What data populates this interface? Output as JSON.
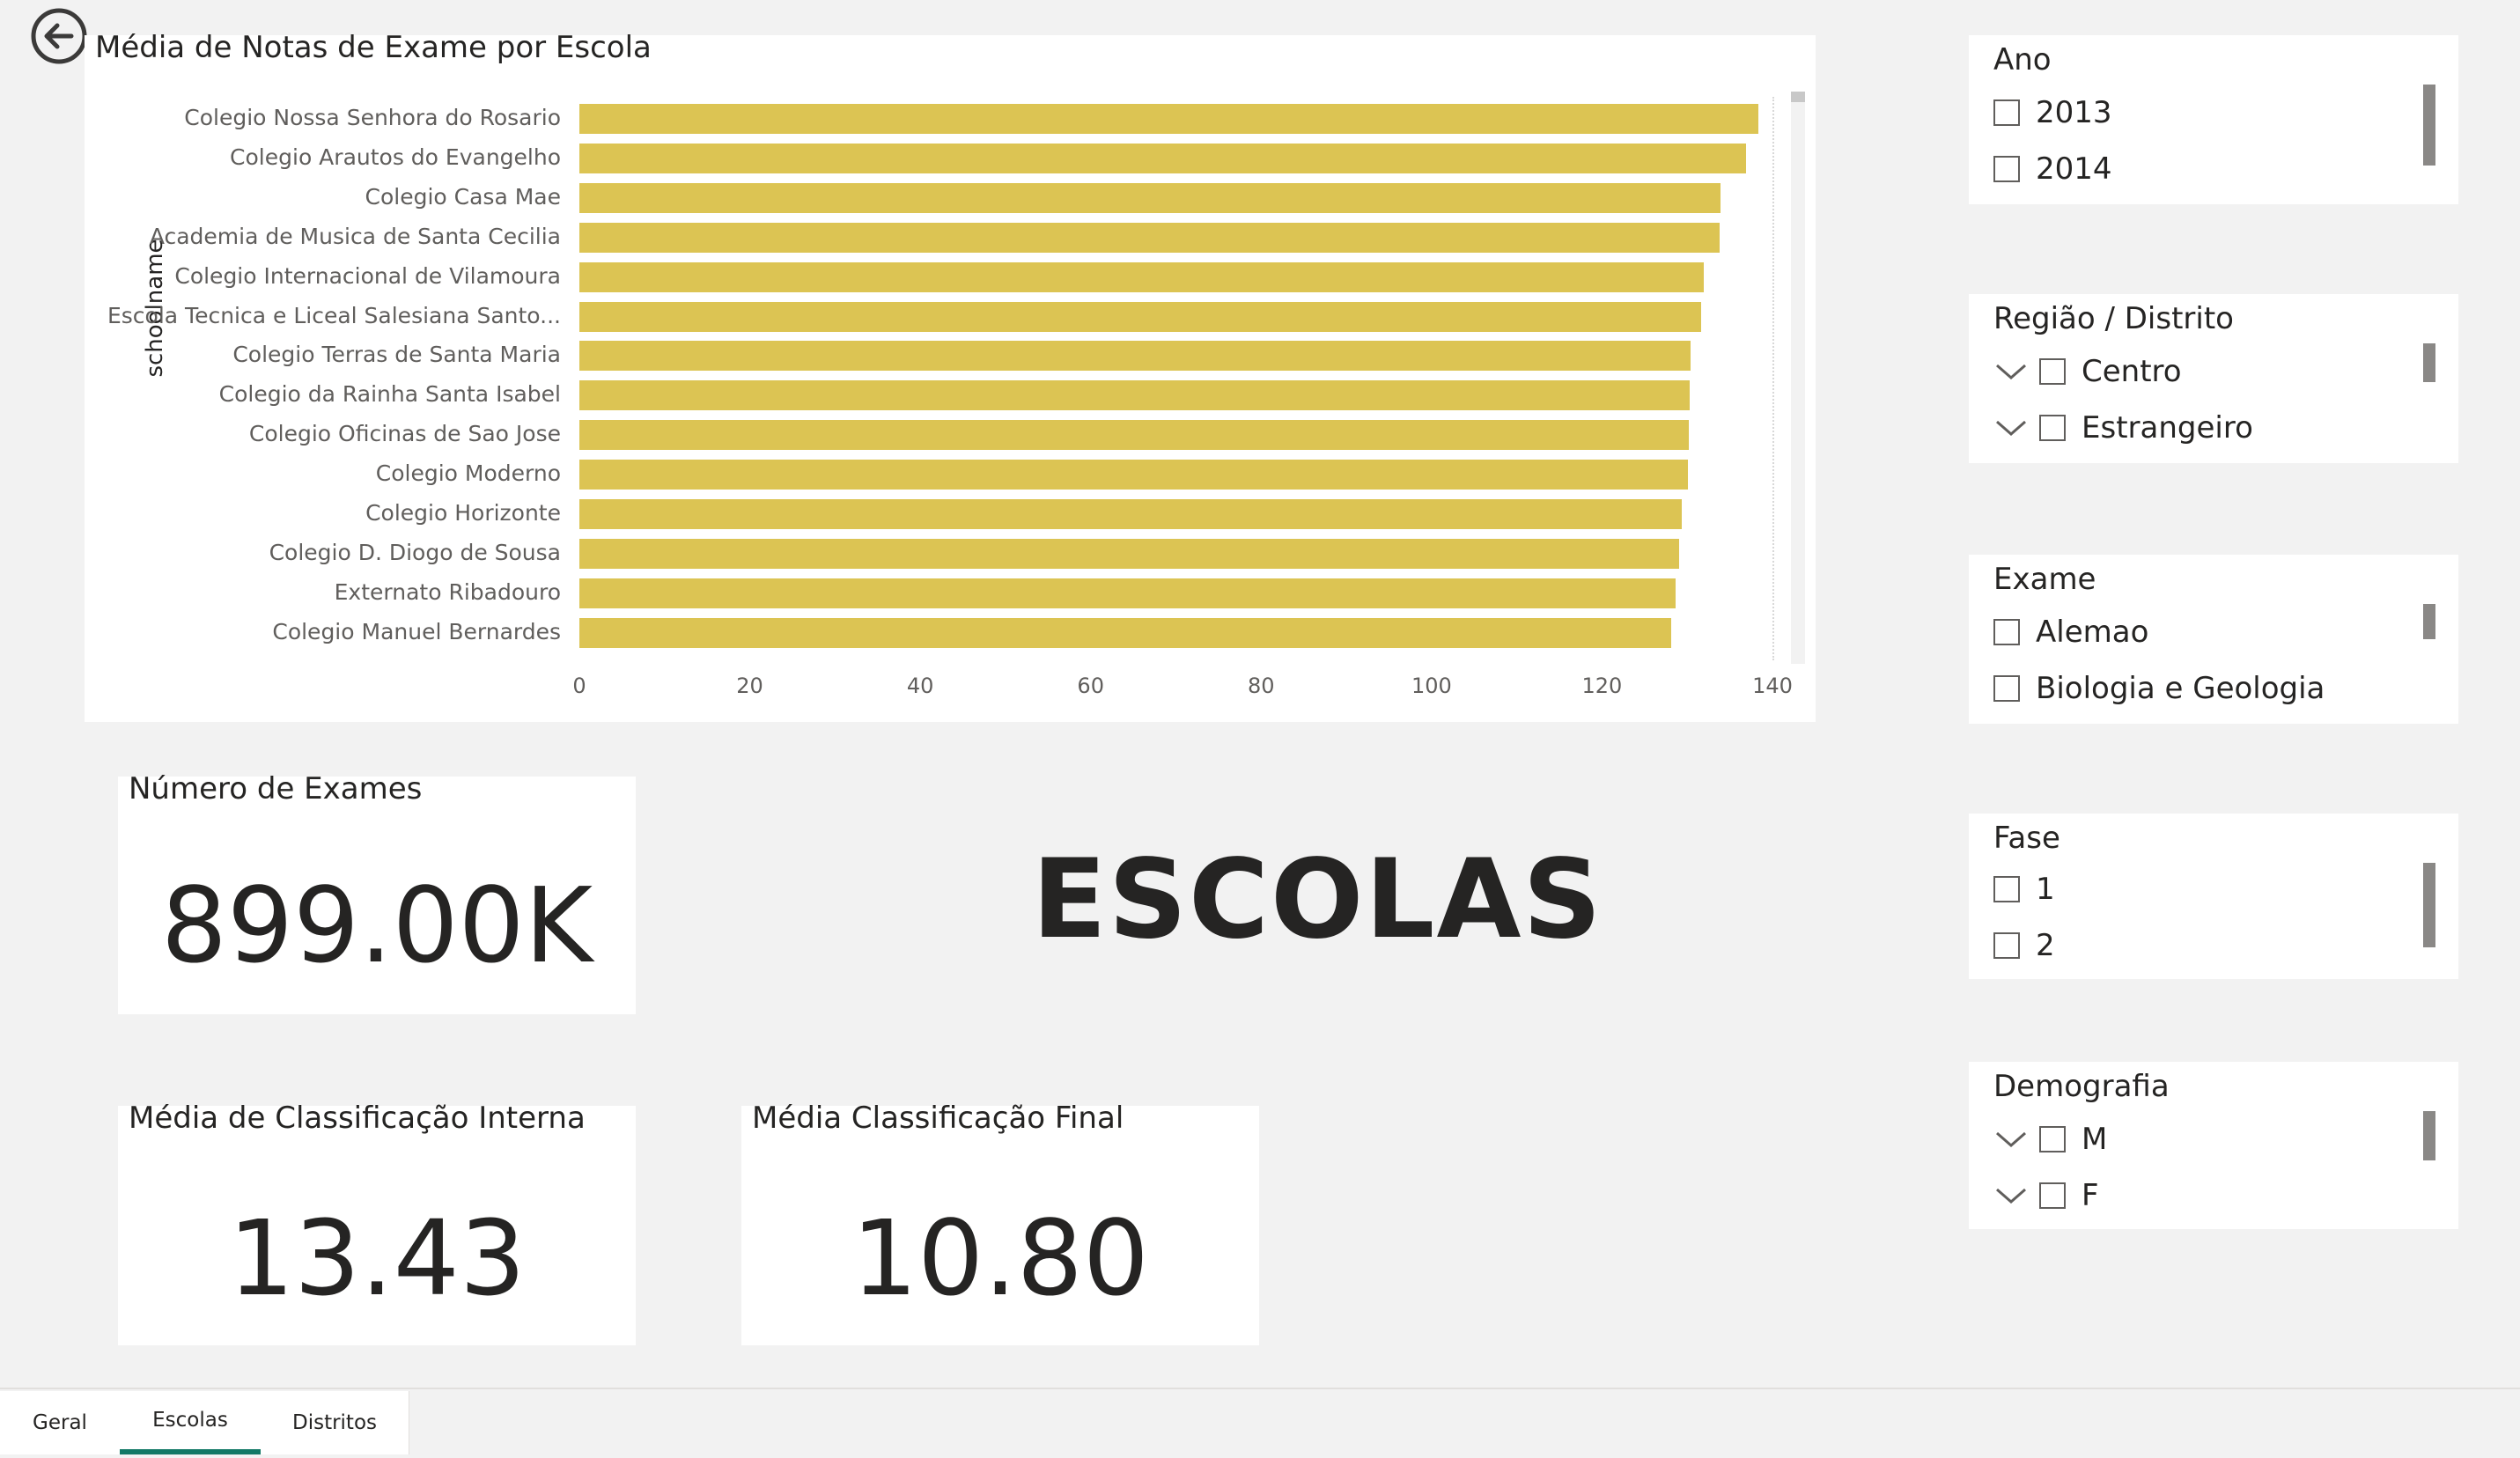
{
  "chart": {
    "title": "Média de Notas de Exame por Escola",
    "ylabel": "schoolname"
  },
  "chart_data": {
    "type": "bar",
    "orientation": "horizontal",
    "title": "Média de Notas de Exame por Escola",
    "ylabel": "schoolname",
    "xlabel": "",
    "xlim": [
      0,
      140
    ],
    "x_ticks": [
      "0",
      "20",
      "40",
      "60",
      "80",
      "100",
      "120",
      "140"
    ],
    "categories": [
      "Colegio Nossa Senhora do Rosario",
      "Colegio Arautos do Evangelho",
      "Colegio Casa Mae",
      "Academia de Musica de Santa Cecilia",
      "Colegio Internacional de Vilamoura",
      "Escola Tecnica e Liceal Salesiana Santo...",
      "Colegio Terras de Santa Maria",
      "Colegio da Rainha Santa Isabel",
      "Colegio Oficinas de Sao Jose",
      "Colegio Moderno",
      "Colegio Horizonte",
      "Colegio D. Diogo de Sousa",
      "Externato Ribadouro",
      "Colegio Manuel Bernardes"
    ],
    "values": [
      138.3,
      136.9,
      133.9,
      133.8,
      131.9,
      131.6,
      130.4,
      130.3,
      130.2,
      130.1,
      129.4,
      129.0,
      128.6,
      128.1
    ],
    "color": "#dcc453",
    "grid": false
  },
  "kpis": {
    "exams": {
      "title": "Número de Exames",
      "value": "899.00K"
    },
    "internal": {
      "title": "Média de Classificação Interna",
      "value": "13.43"
    },
    "final": {
      "title": "Média Classificação Final",
      "value": "10.80"
    }
  },
  "page_heading": "ESCOLAS",
  "slicers": {
    "ano": {
      "title": "Ano",
      "items": [
        "2013",
        "2014"
      ]
    },
    "regiao": {
      "title": "Região / Distrito",
      "items": [
        "Centro",
        "Estrangeiro"
      ]
    },
    "exame": {
      "title": "Exame",
      "items": [
        "Alemao",
        "Biologia e Geologia"
      ]
    },
    "fase": {
      "title": "Fase",
      "items": [
        "1",
        "2"
      ]
    },
    "demografia": {
      "title": "Demografia",
      "items": [
        "M",
        "F"
      ]
    }
  },
  "tabs": [
    "Geral",
    "Escolas",
    "Distritos"
  ],
  "active_tab": "Escolas"
}
